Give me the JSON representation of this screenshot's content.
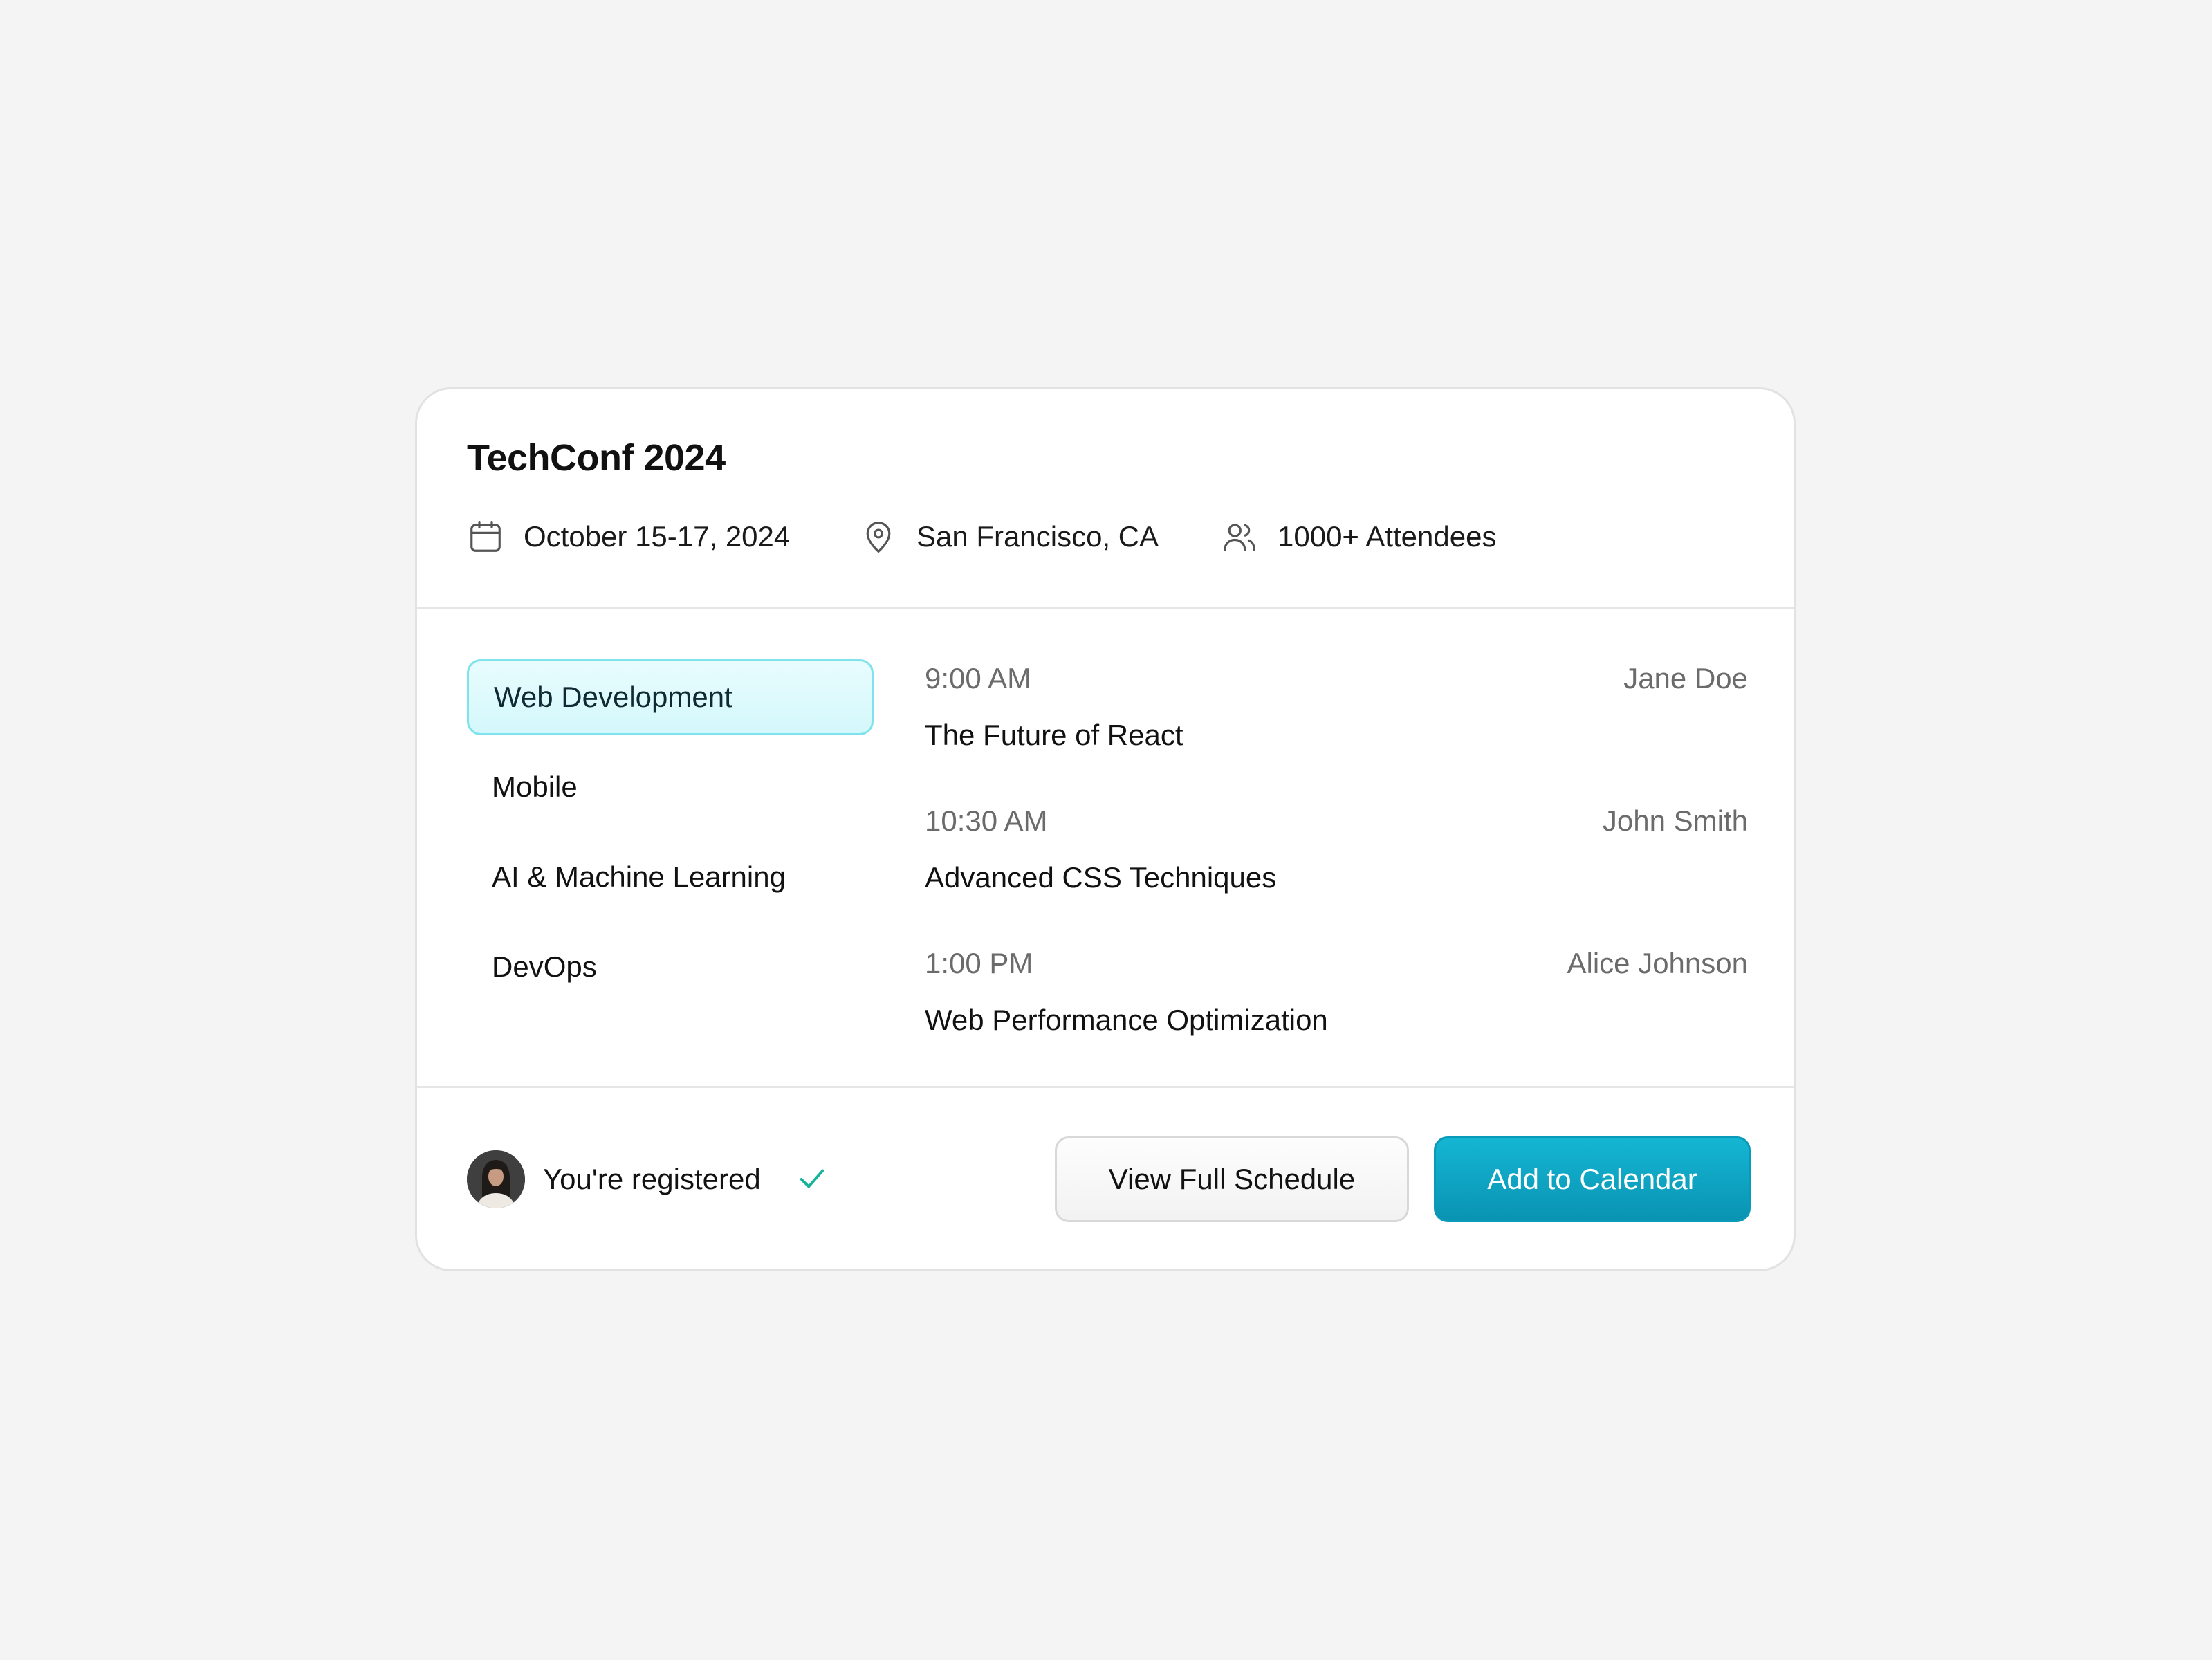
{
  "event": {
    "title": "TechConf 2024",
    "date": "October 15-17, 2024",
    "location": "San Francisco, CA",
    "attendees": "1000+ Attendees"
  },
  "icons": {
    "date": "calendar-icon",
    "location": "map-pin-icon",
    "attendees": "users-icon",
    "registered": "check-icon"
  },
  "tracks": [
    {
      "label": "Web Development",
      "active": true
    },
    {
      "label": "Mobile",
      "active": false
    },
    {
      "label": "AI & Machine Learning",
      "active": false
    },
    {
      "label": "DevOps",
      "active": false
    }
  ],
  "sessions": [
    {
      "time": "9:00 AM",
      "speaker": "Jane Doe",
      "title": "The Future of React"
    },
    {
      "time": "10:30 AM",
      "speaker": "John Smith",
      "title": "Advanced CSS Techniques"
    },
    {
      "time": "1:00 PM",
      "speaker": "Alice Johnson",
      "title": "Web Performance Optimization"
    }
  ],
  "footer": {
    "status": "You're registered",
    "view_schedule_label": "View Full Schedule",
    "add_calendar_label": "Add to Calendar"
  },
  "colors": {
    "accent": "#0ea5c6",
    "active_track_bg": "#d9f9fc",
    "active_track_border": "#7ee3ec",
    "success": "#16b39a",
    "muted_text": "#6b6b6b"
  }
}
